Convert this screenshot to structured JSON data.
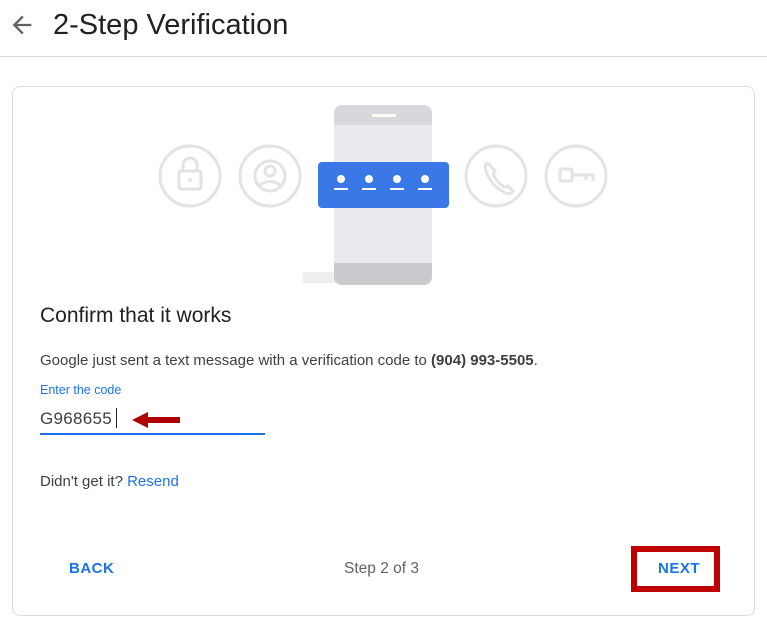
{
  "header": {
    "back_icon": "arrow-left-icon",
    "title": "2-Step Verification"
  },
  "illustration": {
    "icons": [
      "lock-icon",
      "person-icon",
      "phone-icon",
      "key-icon"
    ],
    "code_dots": 4,
    "accent": "#3b78e7"
  },
  "card": {
    "heading": "Confirm that it works",
    "message_prefix": "Google just sent a text message with a verification code to ",
    "phone_number": "(904) 993-5505",
    "message_suffix": ".",
    "field_label": "Enter the code",
    "code_value": "G968655",
    "resend_prefix": "Didn't get it? ",
    "resend_link": "Resend"
  },
  "footer": {
    "back_label": "BACK",
    "step_text": "Step 2 of 3",
    "next_label": "NEXT"
  },
  "colors": {
    "accent": "#1a73e8",
    "highlight": "#c00000"
  }
}
